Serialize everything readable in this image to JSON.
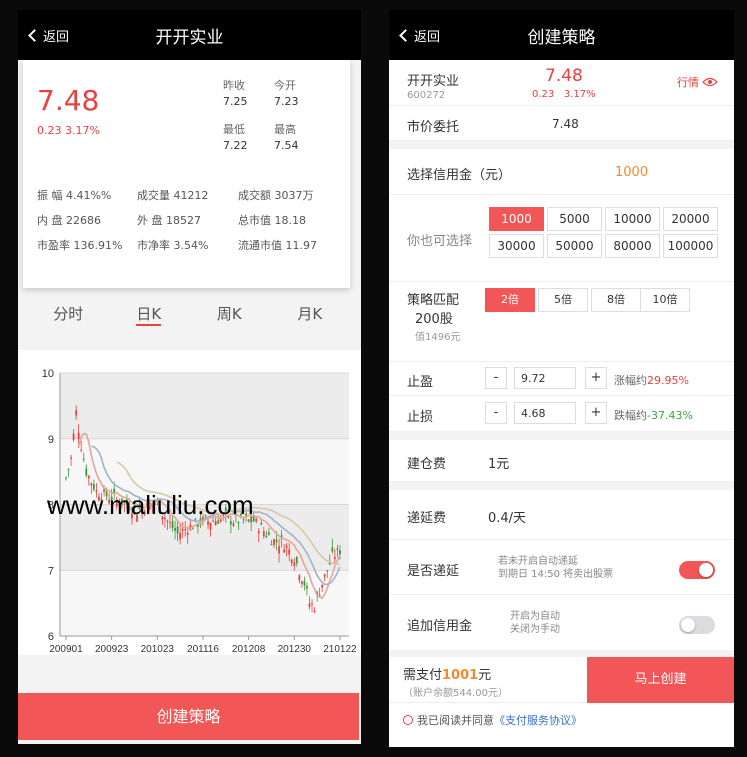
{
  "left": {
    "header": {
      "back": "返回",
      "title": "开开实业"
    },
    "quote": {
      "price": "7.48",
      "change": "0.23 3.17%",
      "prev_close_label": "昨收",
      "prev_close": "7.25",
      "open_label": "今开",
      "open": "7.23",
      "low_label": "最低",
      "low": "7.22",
      "high_label": "最高",
      "high": "7.54",
      "stats": [
        [
          "振 幅 4.41%%",
          "成交量 41212",
          "成交额 3037万"
        ],
        [
          "内 盘 22686",
          "外 盘 18527",
          "总市值 18.18"
        ],
        [
          "市盈率 136.91%",
          "市净率 3.54%",
          "流通市值 11.97"
        ]
      ]
    },
    "tabs": [
      "分时",
      "日K",
      "周K",
      "月K"
    ],
    "active_tab": 1,
    "watermark": "www.maliuliu.com",
    "create_button": "创建策略"
  },
  "chart_data": {
    "type": "candlestick",
    "y_ticks": [
      "10",
      "9",
      "8",
      "7",
      "6"
    ],
    "ylim": [
      6,
      10
    ],
    "x_ticks": [
      "200901",
      "200923",
      "201023",
      "201116",
      "201208",
      "201230",
      "210122"
    ],
    "grid": true,
    "close_path": [
      [
        0,
        8.4
      ],
      [
        2,
        8.7
      ],
      [
        4,
        9.4
      ],
      [
        6,
        8.9
      ],
      [
        8,
        8.5
      ],
      [
        12,
        8.2
      ],
      [
        18,
        8.1
      ],
      [
        24,
        8.0
      ],
      [
        28,
        7.9
      ],
      [
        32,
        8.0
      ],
      [
        36,
        8.0
      ],
      [
        40,
        7.75
      ],
      [
        44,
        7.55
      ],
      [
        48,
        7.65
      ],
      [
        54,
        7.75
      ],
      [
        58,
        7.75
      ],
      [
        62,
        7.8
      ],
      [
        66,
        7.75
      ],
      [
        70,
        7.75
      ],
      [
        74,
        7.75
      ],
      [
        78,
        7.6
      ],
      [
        82,
        7.45
      ],
      [
        86,
        7.4
      ],
      [
        90,
        7.2
      ],
      [
        92,
        7.0
      ],
      [
        94,
        6.8
      ],
      [
        96,
        6.5
      ],
      [
        98,
        6.45
      ],
      [
        100,
        6.7
      ],
      [
        102,
        6.9
      ],
      [
        105,
        7.2
      ],
      [
        108,
        7.3
      ]
    ],
    "series": [
      {
        "color": "#e8a596"
      },
      {
        "color": "#a0b3c8"
      },
      {
        "color": "#d8c9a6"
      }
    ],
    "up_color": "#e8413f",
    "down_color": "#3a9a3a"
  },
  "right": {
    "header": {
      "back": "返回",
      "title": "创建策略"
    },
    "stock": {
      "name": "开开实业",
      "code": "600272",
      "price": "7.48",
      "change": "0.23",
      "change_pct": "3.17%",
      "market_link": "行情"
    },
    "market_order": {
      "label": "市价委托",
      "value": "7.48"
    },
    "credit": {
      "label": "选择信用金（元）",
      "value": "1000"
    },
    "choose": {
      "label": "你也可选择",
      "options": [
        "1000",
        "5000",
        "10000",
        "20000",
        "30000",
        "50000",
        "80000",
        "100000"
      ],
      "selected": 0
    },
    "match": {
      "label": "策略匹配",
      "shares": "200股",
      "value_text": "值1496元",
      "options": [
        "2倍",
        "5倍",
        "8倍",
        "10倍"
      ],
      "selected": 0
    },
    "take_profit": {
      "label": "止盈",
      "minus": "-",
      "plus": "+",
      "value": "9.72",
      "note_prefix": "涨幅约",
      "note_value": "29.95%"
    },
    "stop_loss": {
      "label": "止损",
      "minus": "-",
      "plus": "+",
      "value": "4.68",
      "note_prefix": "跌幅约",
      "note_value": "-37.43%"
    },
    "build_fee": {
      "label": "建仓费",
      "value": "1元"
    },
    "defer_fee": {
      "label": "递延费",
      "value": "0.4/天"
    },
    "defer": {
      "label": "是否递延",
      "hint1": "若未开启自动递延",
      "hint2": "到期日 14:50 将卖出股票",
      "on": true
    },
    "add_credit": {
      "label": "追加信用金",
      "hint1": "开启为自动",
      "hint2": "关闭为手动",
      "on": false
    },
    "footer": {
      "pay_prefix": "需支付",
      "pay_amount": "1001",
      "pay_suffix": "元",
      "balance": "（账户余额544.00元）",
      "button": "马上创建"
    },
    "agreement": {
      "text": "我已阅读并同意",
      "link": "《支付服务协议》"
    },
    "colors": {
      "accent": "#f25656",
      "orange": "#f08a2c",
      "green": "#3aa83a",
      "header": "#000000"
    }
  }
}
